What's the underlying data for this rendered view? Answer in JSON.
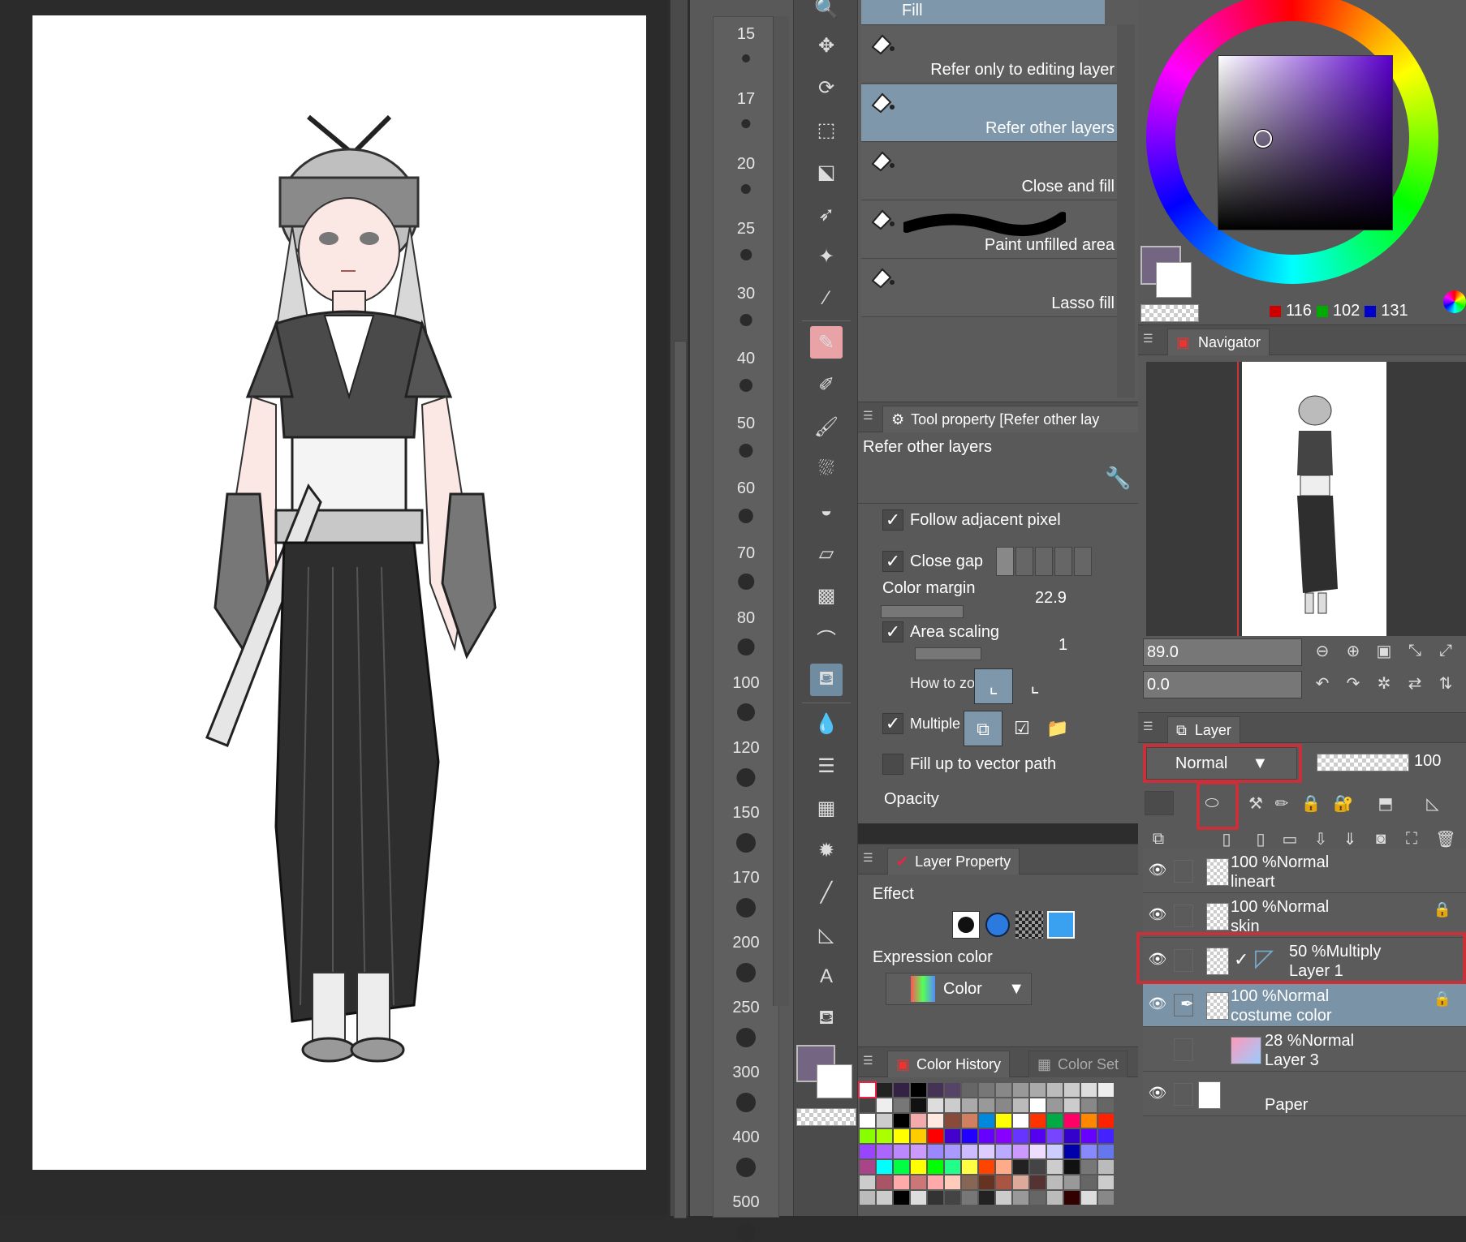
{
  "colors": {
    "accent": "#7e97aa",
    "highlight": "#c8303a",
    "current_color": "#746683"
  },
  "size_list": {
    "values": [
      "15",
      "17",
      "20",
      "25",
      "30",
      "40",
      "50",
      "60",
      "70",
      "80",
      "100",
      "120",
      "150",
      "170",
      "200",
      "250",
      "300",
      "400",
      "500"
    ]
  },
  "subtools": {
    "items": [
      {
        "label": "Fill",
        "selected": false
      },
      {
        "label": "Refer only to editing layer",
        "selected": false
      },
      {
        "label": "Refer other layers",
        "selected": true
      },
      {
        "label": "Close and fill",
        "selected": false
      },
      {
        "label": "Paint unfilled area",
        "selected": false
      },
      {
        "label": "Lasso fill",
        "selected": false
      }
    ]
  },
  "tool_property": {
    "tab_label": "Tool property [Refer other lay",
    "subtool_name": "Refer other layers",
    "follow_adjacent_label": "Follow adjacent pixel",
    "close_gap_label": "Close gap",
    "color_margin_label": "Color margin",
    "color_margin_value": "22.9",
    "area_scaling_label": "Area scaling",
    "area_scaling_value": "1",
    "how_to_label": "How to zo",
    "multiple_label": "Multiple",
    "fill_vector_label": "Fill up to vector path",
    "opacity_label": "Opacity"
  },
  "layer_property": {
    "tab_label": "Layer Property",
    "effect_label": "Effect",
    "expression_color_label": "Expression color",
    "expression_color_value": "Color"
  },
  "color_history": {
    "tab_label": "Color History",
    "tab2_label": "Color Set"
  },
  "color_wheel": {
    "r": "116",
    "g": "102",
    "b": "131"
  },
  "navigator": {
    "tab_label": "Navigator",
    "zoom": "89.0",
    "rotation": "0.0"
  },
  "layer_panel": {
    "tab_label": "Layer",
    "blend_mode": "Normal",
    "opacity": "100",
    "layers": [
      {
        "line1": "100 %Normal",
        "line2": "lineart",
        "locked": false,
        "selected": false,
        "visible": true
      },
      {
        "line1": "100 %Normal",
        "line2": "skin",
        "locked": true,
        "selected": false,
        "visible": true
      },
      {
        "line1": "50 %Multiply",
        "line2": "Layer 1",
        "locked": false,
        "selected": false,
        "visible": true
      },
      {
        "line1": "100 %Normal",
        "line2": "costume color",
        "locked": true,
        "selected": true,
        "visible": true
      },
      {
        "line1": "28 %Normal",
        "line2": "Layer 3",
        "locked": false,
        "selected": false,
        "visible": false
      },
      {
        "line1": "",
        "line2": "Paper",
        "locked": false,
        "selected": false,
        "visible": true
      }
    ]
  }
}
